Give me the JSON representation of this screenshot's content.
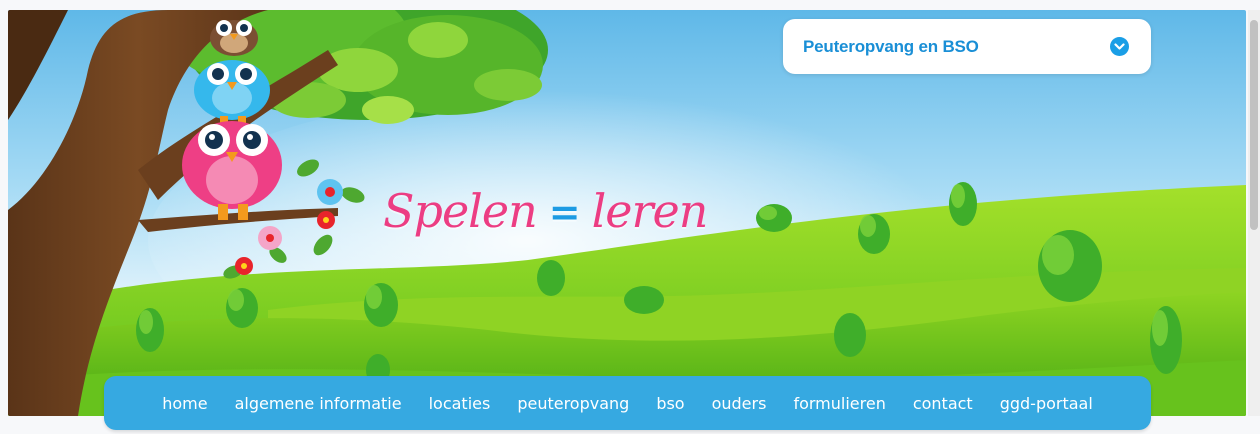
{
  "dropdown": {
    "selected": "Peuteropvang en BSO",
    "icon": "chevron-down-circle-icon",
    "accent": "#1a8fd6"
  },
  "banner": {
    "tagline_left": "Spelen",
    "tagline_eq": "=",
    "tagline_right": "leren",
    "tagline_color": "#ec3d83",
    "eq_color": "#1d9be3"
  },
  "nav": {
    "background": "#36a9e1",
    "items": [
      {
        "label": "home"
      },
      {
        "label": "algemene informatie"
      },
      {
        "label": "locaties"
      },
      {
        "label": "peuteropvang"
      },
      {
        "label": "bso"
      },
      {
        "label": "ouders"
      },
      {
        "label": "formulieren"
      },
      {
        "label": "contact"
      },
      {
        "label": "ggd-portaal"
      }
    ]
  }
}
